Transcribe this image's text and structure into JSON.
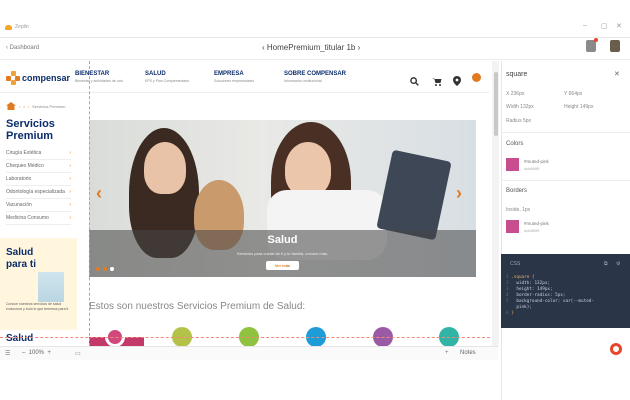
{
  "app": {
    "name": "Zeplin"
  },
  "toolbar": {
    "back_label": "Dashboard",
    "doc_title": "HomePremium_titular 1b"
  },
  "site": {
    "logo_text": "compensar",
    "nav": [
      {
        "title": "BIENESTAR",
        "sub": "Bienestar y actividades de ocio"
      },
      {
        "title": "SALUD",
        "sub": "EPS y Plan Complementario"
      },
      {
        "title": "EMPRESA",
        "sub": "Soluciones empresariales"
      },
      {
        "title": "SOBRE COMPENSAR",
        "sub": "Información institucional"
      }
    ],
    "breadcrumb": {
      "current": "Servicios Premium"
    },
    "sidebar": {
      "title": "Servicios Premium",
      "items": [
        {
          "label": "Cirugía Estética"
        },
        {
          "label": "Chequeo Médico"
        },
        {
          "label": "Laboratorio"
        },
        {
          "label": "Odontología especializada"
        },
        {
          "label": "Vacunación"
        },
        {
          "label": "Medicina Consumo"
        }
      ]
    },
    "promo": {
      "title": "Salud para ti",
      "text": "Conoce nuestros servicios de salud exclusivos y todo lo que tenemos para ti"
    },
    "promo2_title": "Salud",
    "carousel": {
      "title": "Salud",
      "subtitle": "Servicios para cuidar de ti y tu familia, conoce más.",
      "button": "Ver más"
    },
    "section_title": "Estos son nuestros Servicios Premium de Salud:"
  },
  "bottombar": {
    "zoom": "100%",
    "notes": "Notes"
  },
  "inspector": {
    "layer_name": "square",
    "x": "X  236px",
    "y": "Y  664px",
    "width": "Width  132px",
    "height": "Height  149px",
    "radius": "Radius  5px",
    "colors_label": "Colors",
    "borders_label": "Borders",
    "border_desc": "Inside, 1px",
    "color_name": "#muted-pink",
    "color_hex": "#cb6699",
    "css_label": "CSS",
    "css_lines": [
      {
        "n": "1",
        "t": ".square {"
      },
      {
        "n": "2",
        "t": "  width: 132px;"
      },
      {
        "n": "3",
        "t": "  height: 149px;"
      },
      {
        "n": "4",
        "t": "  border-radius: 5px;"
      },
      {
        "n": "5",
        "t": "  background-color: var(--muted-"
      },
      {
        "n": "",
        "t": "  pink);"
      },
      {
        "n": "6",
        "t": "}"
      }
    ]
  },
  "colors": {
    "accent": "#e07b22",
    "brand_blue": "#0b2d6b",
    "swatch": "#c74d8f",
    "css_bg": "#2b3548"
  }
}
